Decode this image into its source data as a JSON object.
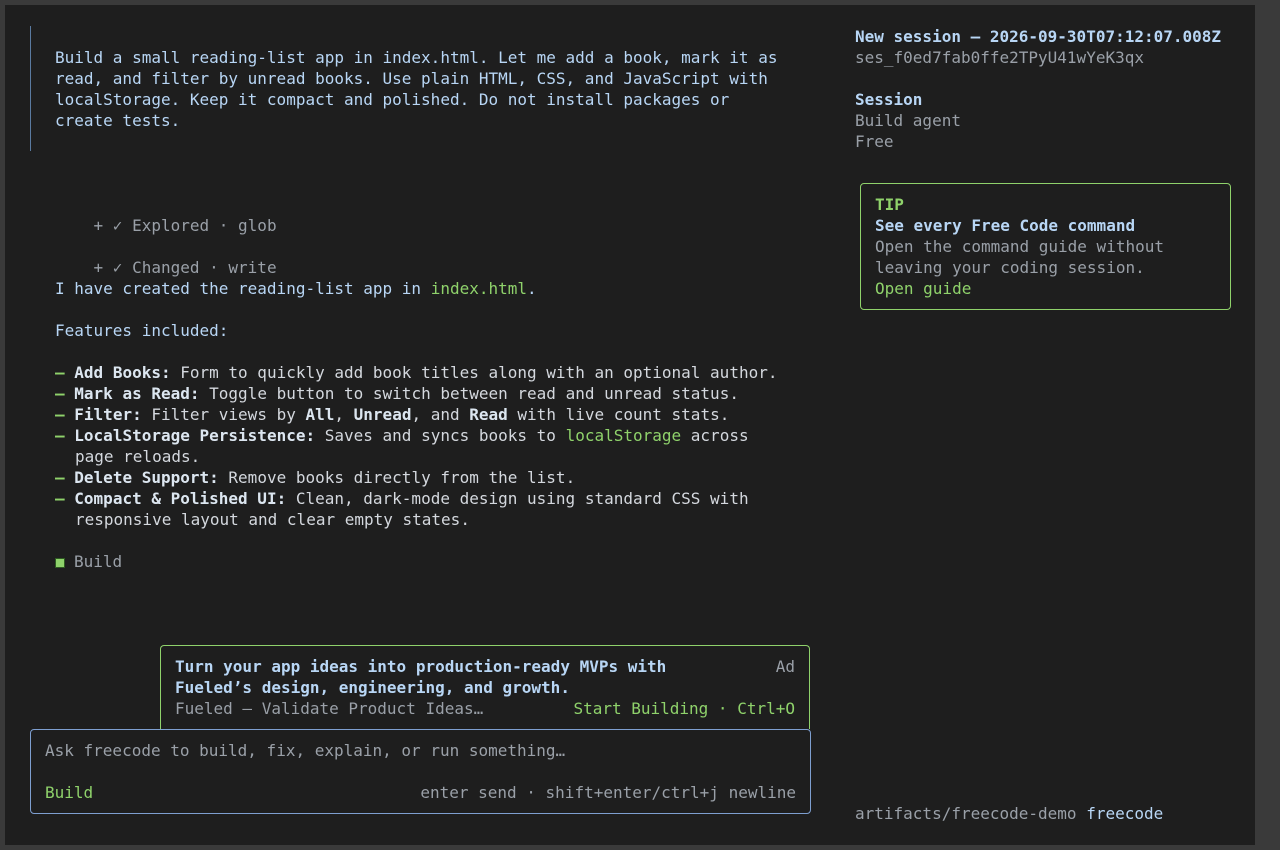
{
  "prompt": {
    "text": "Build a small reading-list app in index.html. Let me add a book, mark it as\nread, and filter by unread books. Use plain HTML, CSS, and JavaScript with\nlocalStorage. Keep it compact and polished. Do not install packages or\ncreate tests."
  },
  "tool_calls": [
    {
      "prefix": "+ ✓",
      "label": "Explored · glob"
    },
    {
      "prefix": "+ ✓",
      "label": "Changed · write"
    }
  ],
  "response": {
    "intro_text": "I have created the reading-list app in ",
    "intro_file": "index.html",
    "intro_end": ".",
    "features_heading": "Features included:",
    "bullet": "–",
    "features": [
      {
        "key": "Add Books:",
        "text": " Form to quickly add book titles along with an optional author."
      },
      {
        "key": "Mark as Read:",
        "text": " Toggle button to switch between read and unread status."
      },
      {
        "key": "Filter:",
        "text": " Filter views by ",
        "b1": "All",
        "t2": ", ",
        "b2": "Unread",
        "t3": ", and ",
        "b3": "Read",
        "t4": " with live count stats."
      },
      {
        "key": "LocalStorage Persistence:",
        "text": " Saves and syncs books to ",
        "code": "localStorage",
        "t2": " across",
        "cont": "page reloads."
      },
      {
        "key": "Delete Support:",
        "text": " Remove books directly from the list."
      },
      {
        "key": "Compact & Polished UI:",
        "text": " Clean, dark-mode design using standard CSS with",
        "cont": "responsive layout and clear empty states."
      }
    ],
    "agent_label": "Build"
  },
  "ad": {
    "headline_1": "Turn your app ideas into production-ready MVPs with",
    "headline_2": "Fueled’s design, engineering, and growth.",
    "tag": "Ad",
    "source": "Fueled — Validate Product Ideas…",
    "cta": "Start Building · Ctrl+O"
  },
  "input": {
    "placeholder": "Ask freecode to build, fix, explain, or run something…",
    "mode": "Build",
    "hint": "enter send · shift+enter/ctrl+j newline"
  },
  "sidebar": {
    "session_title": "New session – 2026-09-30T07:12:07.008Z",
    "session_id": "ses_f0ed7fab0ffe2TPyU41wYeK3qx",
    "section_label": "Session",
    "agent": "Build agent",
    "plan": "Free",
    "tip": {
      "label": "TIP",
      "title": "See every Free Code command",
      "body_1": "Open the command guide without",
      "body_2": "leaving your coding session.",
      "link": "Open guide"
    },
    "footer_path": "artifacts/freecode-demo",
    "footer_app": "freecode"
  },
  "colors": {
    "background": "#1e1e1e",
    "accent_green": "#8fd26b",
    "accent_blue": "#7e9fd0",
    "text_light_blue": "#b8d6f5"
  }
}
